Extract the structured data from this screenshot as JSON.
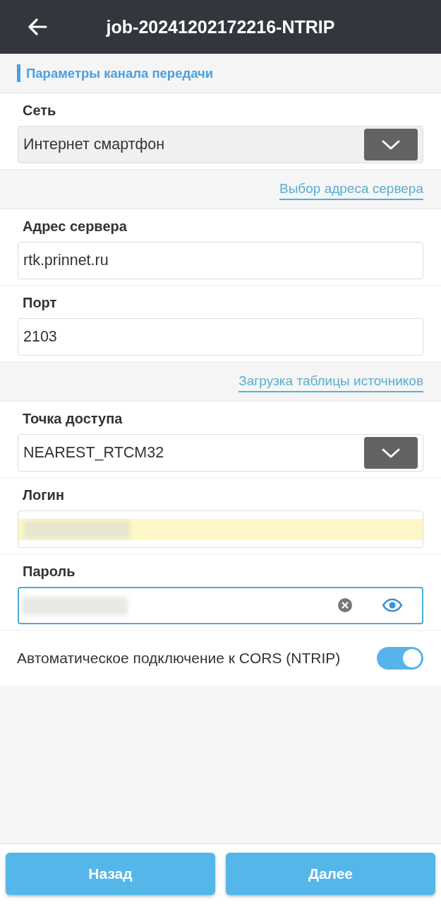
{
  "header": {
    "title": "job-20241202172216-NTRIP"
  },
  "section": {
    "title": "Параметры канала передачи"
  },
  "rows": [
    {
      "kind": "select",
      "label": "Сеть",
      "value": "Интернет смартфон",
      "shaded": true
    },
    {
      "kind": "link",
      "text": "Выбор адреса сервера"
    },
    {
      "kind": "input",
      "label": "Адрес сервера",
      "value": "rtk.prinnet.ru",
      "focused": false,
      "autofilled": false,
      "redacted": false
    },
    {
      "kind": "input",
      "label": "Порт",
      "value": "2103",
      "focused": false,
      "autofilled": false,
      "redacted": false
    },
    {
      "kind": "link",
      "text": "Загрузка таблицы источников"
    },
    {
      "kind": "select",
      "label": "Точка доступа",
      "value": "NEAREST_RTCM32",
      "shaded": false
    },
    {
      "kind": "input",
      "label": "Логин",
      "focused": false,
      "autofilled": true,
      "redacted": true
    },
    {
      "kind": "password",
      "label": "Пароль",
      "focused": true,
      "autofilled": false,
      "redacted": true
    },
    {
      "kind": "toggle",
      "label": "Автоматическое подключение к CORS (NTRIP)",
      "on": true
    }
  ],
  "footer": {
    "buttons": [
      "Назад",
      "Далее"
    ]
  }
}
